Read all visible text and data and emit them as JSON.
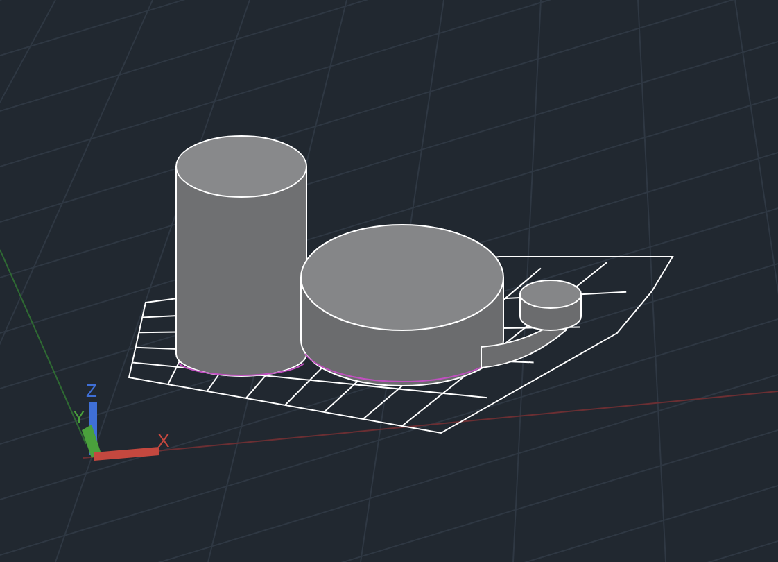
{
  "viewport": {
    "ucs_icon": {
      "axes": [
        {
          "label": "Z",
          "color": "#3f6fd6"
        },
        {
          "label": "Y",
          "color": "#4aa03c"
        },
        {
          "label": "X",
          "color": "#c4483f"
        }
      ]
    }
  }
}
